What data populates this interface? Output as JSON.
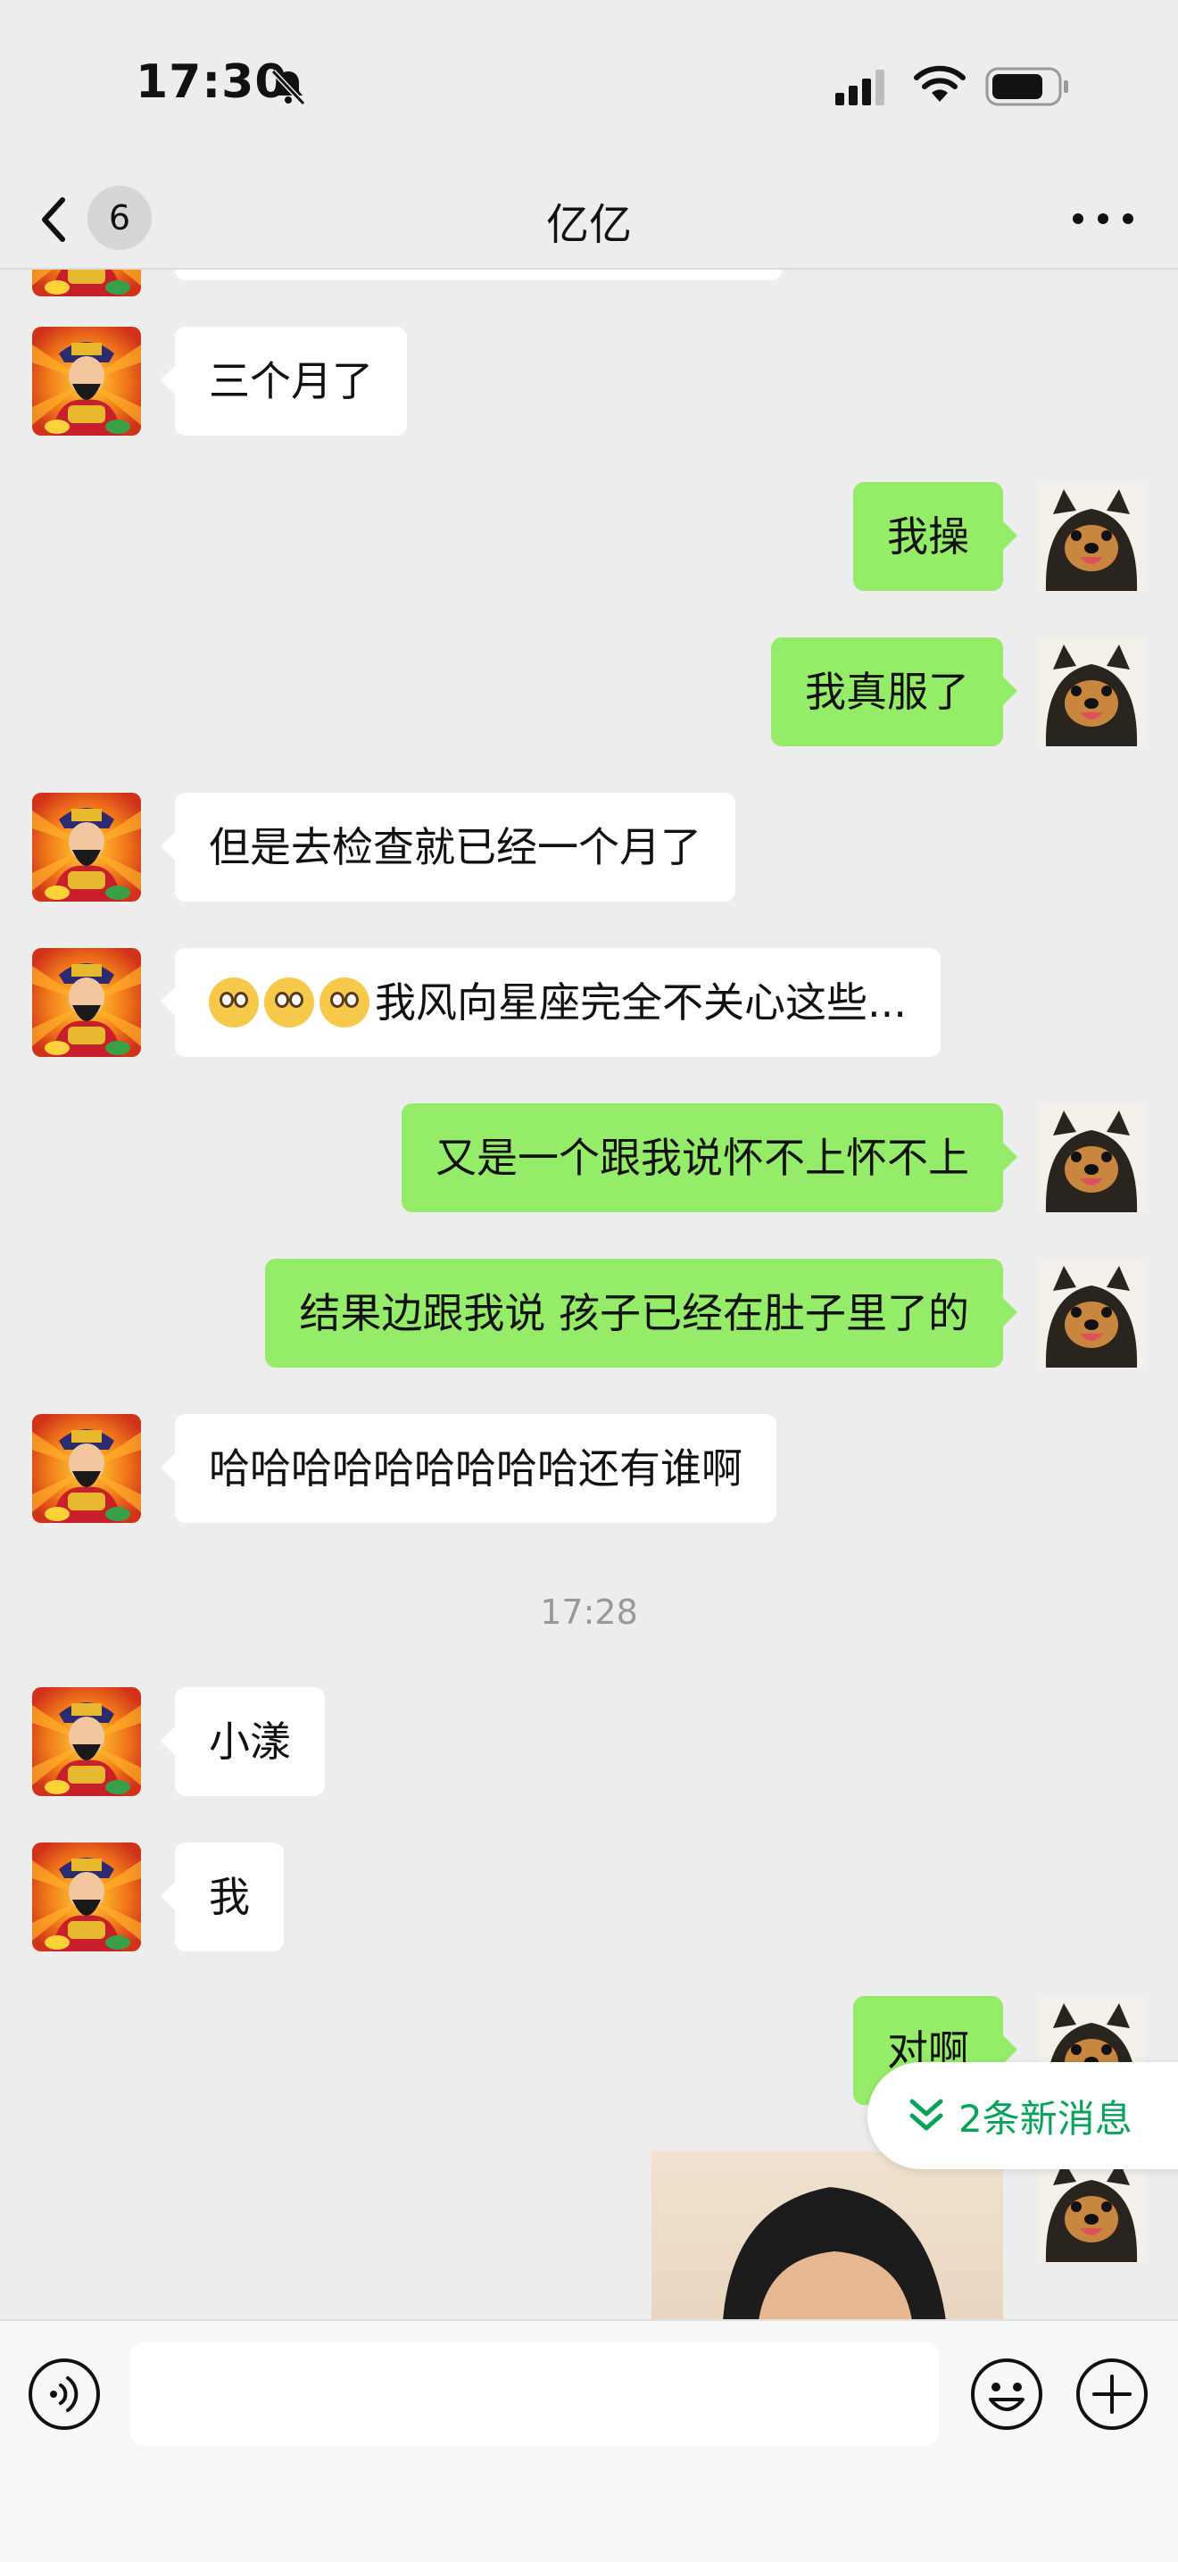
{
  "status_bar": {
    "time": "17:30"
  },
  "nav": {
    "unread_count": "6",
    "title": "亿亿"
  },
  "messages": [
    {
      "side": "in",
      "text": "三个月了"
    },
    {
      "side": "out",
      "text": "我操"
    },
    {
      "side": "out",
      "text": "我真服了"
    },
    {
      "side": "in",
      "text": "但是去检查就已经一个月了"
    },
    {
      "side": "in",
      "text": "我风向星座完全不关心这些..."
    },
    {
      "side": "out",
      "text": "又是一个跟我说怀不上怀不上"
    },
    {
      "side": "out",
      "text": "结果边跟我说 孩子已经在肚子里了的"
    },
    {
      "side": "in",
      "text": "哈哈哈哈哈哈哈哈哈还有谁啊"
    },
    {
      "side": "in",
      "text": "小漾"
    },
    {
      "side": "in",
      "text": "我"
    },
    {
      "side": "out",
      "text": "对啊"
    }
  ],
  "timestamp": "17:28",
  "new_messages_label": "2条新消息",
  "colors": {
    "background": "#ededed",
    "outgoing_bubble": "#95ec69",
    "incoming_bubble": "#ffffff",
    "accent_green": "#07a35a"
  },
  "icons": [
    "chevron-left-icon",
    "more-icon",
    "voice-icon",
    "emoji-icon",
    "plus-icon",
    "double-chevron-down-icon",
    "bell-slash-icon",
    "signal-icon",
    "wifi-icon",
    "battery-icon"
  ]
}
